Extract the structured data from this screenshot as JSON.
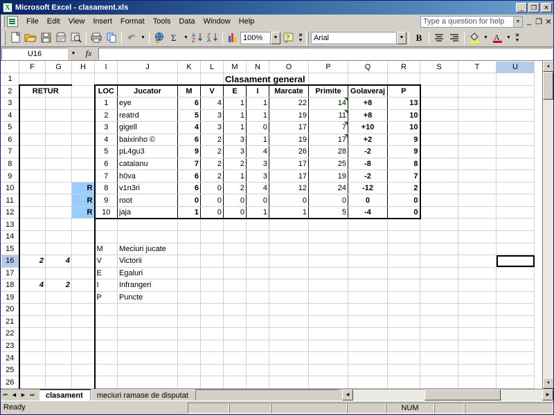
{
  "window": {
    "title": "Microsoft Excel - clasament.xls",
    "app_icon": "excel-logo-icon",
    "minimize": "_",
    "maximize": "❐",
    "close": "✕"
  },
  "menubar": {
    "items": [
      "File",
      "Edit",
      "View",
      "Insert",
      "Format",
      "Tools",
      "Data",
      "Window",
      "Help"
    ],
    "help_search_placeholder": "Type a question for help",
    "doc_minimize": "_",
    "doc_restore": "❐",
    "doc_close": "✕"
  },
  "toolbar": {
    "zoom_value": "100%",
    "font_name": "Arial",
    "bold_label": "B",
    "overflow_label": "»",
    "icons": [
      "new-icon",
      "open-icon",
      "save-icon",
      "email-icon",
      "search-icon",
      "print-icon",
      "copy-icon",
      "undo-icon",
      "hyperlink-icon",
      "autosum-icon",
      "sort-ascending-icon",
      "sort-descending-icon",
      "chart-wizard-icon",
      "help-icon",
      "fill-color-icon",
      "font-color-icon",
      "align-center-icon",
      "align-right-icon"
    ]
  },
  "formula_bar": {
    "name_box": "U16",
    "fx_label": "fx",
    "formula_value": ""
  },
  "sheet": {
    "columns": [
      "F",
      "G",
      "H",
      "I",
      "J",
      "K",
      "L",
      "M",
      "N",
      "O",
      "P",
      "Q",
      "R",
      "S",
      "T",
      "U"
    ],
    "selected_column": "U",
    "selected_row": 16,
    "rows": [
      1,
      2,
      3,
      4,
      5,
      6,
      7,
      8,
      9,
      10,
      11,
      12,
      13,
      14,
      15,
      16,
      17,
      18,
      19,
      20,
      21,
      22,
      23,
      24,
      25,
      26
    ],
    "title_cell": "Clasament general",
    "retur_label": "RETUR",
    "headers": [
      "LOC",
      "Jucator",
      "M",
      "V",
      "E",
      "I",
      "Marcate",
      "Primite",
      "Golaveraj",
      "P"
    ],
    "standings": [
      {
        "loc": "1",
        "jucator": "eye",
        "m": "6",
        "v": "4",
        "e": "1",
        "i": "1",
        "marcate": "22",
        "primite": "14",
        "golaveraj": "+8",
        "p": "13",
        "r": "",
        "comment": true
      },
      {
        "loc": "2",
        "jucator": "reatrd",
        "m": "5",
        "v": "3",
        "e": "1",
        "i": "1",
        "marcate": "19",
        "primite": "11",
        "golaveraj": "+8",
        "p": "10",
        "r": "",
        "comment": true
      },
      {
        "loc": "3",
        "jucator": "gigell",
        "m": "4",
        "v": "3",
        "e": "1",
        "i": "0",
        "marcate": "17",
        "primite": "7",
        "golaveraj": "+10",
        "p": "10",
        "r": "",
        "comment": true
      },
      {
        "loc": "4",
        "jucator": "baixinho ©",
        "m": "6",
        "v": "2",
        "e": "3",
        "i": "1",
        "marcate": "19",
        "primite": "17",
        "golaveraj": "+2",
        "p": "9",
        "r": "",
        "comment": true
      },
      {
        "loc": "5",
        "jucator": "pL4gu3",
        "m": "9",
        "v": "2",
        "e": "3",
        "i": "4",
        "marcate": "26",
        "primite": "28",
        "golaveraj": "-2",
        "p": "9",
        "r": "",
        "comment": false
      },
      {
        "loc": "6",
        "jucator": "catalanu",
        "m": "7",
        "v": "2",
        "e": "2",
        "i": "3",
        "marcate": "17",
        "primite": "25",
        "golaveraj": "-8",
        "p": "8",
        "r": "",
        "comment": false
      },
      {
        "loc": "7",
        "jucator": "h0va",
        "m": "6",
        "v": "2",
        "e": "1",
        "i": "3",
        "marcate": "17",
        "primite": "19",
        "golaveraj": "-2",
        "p": "7",
        "r": "",
        "comment": false
      },
      {
        "loc": "8",
        "jucator": "v1n3ri",
        "m": "6",
        "v": "0",
        "e": "2",
        "i": "4",
        "marcate": "12",
        "primite": "24",
        "golaveraj": "-12",
        "p": "2",
        "r": "R",
        "comment": false
      },
      {
        "loc": "9",
        "jucator": "root",
        "m": "0",
        "v": "0",
        "e": "0",
        "i": "0",
        "marcate": "0",
        "primite": "0",
        "golaveraj": "0",
        "p": "0",
        "r": "R",
        "comment": false
      },
      {
        "loc": "10",
        "jucator": "jaja",
        "m": "1",
        "v": "0",
        "e": "0",
        "i": "1",
        "marcate": "1",
        "primite": "5",
        "golaveraj": "-4",
        "p": "0",
        "r": "R",
        "comment": false
      }
    ],
    "legend": [
      {
        "abbr": "M",
        "meaning": "Meciuri jucate"
      },
      {
        "abbr": "V",
        "meaning": "Victorii"
      },
      {
        "abbr": "E",
        "meaning": "Egaluri"
      },
      {
        "abbr": "I",
        "meaning": "Infrangeri"
      },
      {
        "abbr": "P",
        "meaning": "Puncte"
      }
    ],
    "retur_values": [
      {
        "row": 16,
        "f": "2",
        "g": "4"
      },
      {
        "row": 18,
        "f": "4",
        "g": "2"
      }
    ]
  },
  "sheet_tabs": {
    "first_label": "⏮",
    "prev_label": "◀",
    "next_label": "▶",
    "last_label": "⏭",
    "tabs": [
      {
        "label": "clasament",
        "active": true
      },
      {
        "label": "meciuri ramase de disputat",
        "active": false
      }
    ]
  },
  "status_bar": {
    "status_text": "Ready",
    "num_lock": "NUM"
  }
}
